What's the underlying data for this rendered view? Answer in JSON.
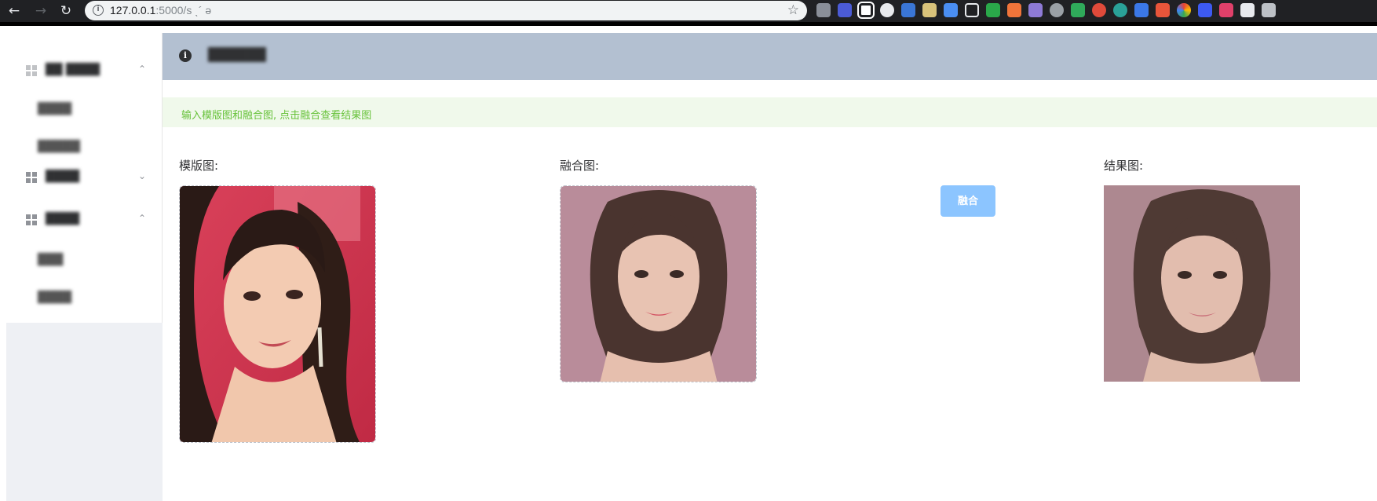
{
  "browser": {
    "url_host": "127.0.0.1",
    "url_rest": ":5000/s",
    "url_tail": "ˎ´ ə"
  },
  "sidebar": {
    "items": [
      {
        "label": "██ ████",
        "type": "group",
        "arrow": "up"
      },
      {
        "label": "████",
        "type": "sub"
      },
      {
        "label": "█████",
        "type": "sub"
      },
      {
        "label": "████",
        "type": "group",
        "arrow": "down"
      },
      {
        "label": "████",
        "type": "group",
        "arrow": "up"
      },
      {
        "label": "███",
        "type": "sub"
      },
      {
        "label": "████",
        "type": "sub"
      }
    ]
  },
  "header": {
    "title": "██████ ",
    "info_icon": "info-icon"
  },
  "alert": {
    "text": "输入模版图和融合图, 点击融合查看结果图"
  },
  "columns": {
    "template_label": "模版图:",
    "fusion_label": "融合图:",
    "result_label": "结果图:"
  },
  "merge_button": {
    "label": "融合"
  },
  "colors": {
    "accent": "#409eff",
    "button_disabled": "#8cc5ff",
    "alert_text": "#67c23a",
    "header_bg": "#b3c0d1"
  }
}
